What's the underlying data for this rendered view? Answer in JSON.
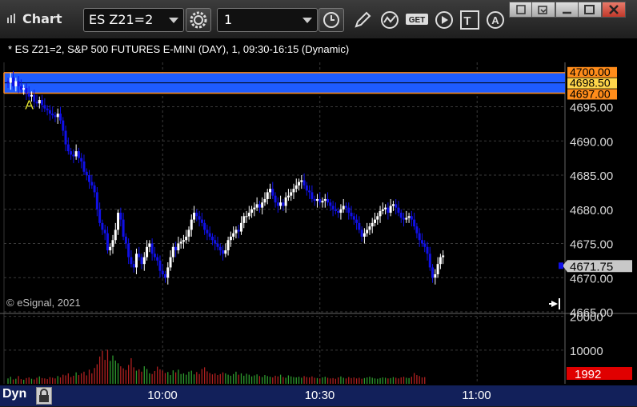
{
  "toolbar": {
    "app_title": "Chart",
    "symbol": "ES Z21=2",
    "interval": "1"
  },
  "chart_info": "* ES Z21=2, S&P 500 FUTURES E-MINI (DAY), 1, 09:30-16:15 (Dynamic)",
  "watermark": "© eSignal, 2021",
  "bottom": {
    "mode": "Dyn"
  },
  "colors": {
    "up": "#ffffff",
    "down": "#1010e8",
    "band": "#1e5cff",
    "band_edge": "#ff8c1a",
    "last_price": "#c8c8c8",
    "vol_up": "#2e9a2e",
    "vol_down": "#b02020",
    "vol_tag": "#e00000"
  },
  "icons": [
    "settings-gear-icon",
    "clock-icon",
    "pencil-draw-icon",
    "study-icon",
    "get-icon",
    "play-icon",
    "text-tool-icon",
    "alert-icon"
  ],
  "chart_data": {
    "type": "candlestick",
    "price_axis": {
      "min": 4665,
      "max": 4700,
      "ticks": [
        4695,
        4690,
        4685,
        4680,
        4675,
        4670,
        4665
      ]
    },
    "price_tick_labels": [
      "4695.00",
      "4690.00",
      "4685.00",
      "4680.00",
      "4675.00",
      "4670.00",
      "4665.00"
    ],
    "levels": [
      {
        "label": "4700.00",
        "value": 4700.0
      },
      {
        "label": "4698.50",
        "value": 4698.5
      },
      {
        "label": "4697.00",
        "value": 4697.0
      }
    ],
    "last_price": {
      "label": "4671.75",
      "value": 4671.75
    },
    "marker": {
      "label": "A"
    },
    "time_labels": [
      {
        "label": "10:00",
        "minute": 30
      },
      {
        "label": "10:30",
        "minute": 60
      },
      {
        "label": "11:00",
        "minute": 90
      }
    ],
    "volume_axis": {
      "min": 0,
      "max": 20000,
      "ticks": [
        20000,
        10000
      ],
      "tick_labels": [
        "20000",
        "10000"
      ]
    },
    "last_volume": {
      "label": "1992",
      "value": 1992
    },
    "first_minute": 0.5,
    "close": [
      4698.5,
      4699.25,
      4698,
      4698.75,
      4698,
      4697.5,
      4697.75,
      4697,
      4696.5,
      4696.75,
      4695.75,
      4695.5,
      4696,
      4695.25,
      4694.75,
      4694.5,
      4694,
      4693.75,
      4693.5,
      4694,
      4693,
      4691.5,
      4689.5,
      4688.5,
      4688,
      4687.75,
      4688.5,
      4687.5,
      4687,
      4685.5,
      4685,
      4684,
      4683.5,
      4682.5,
      4680,
      4678,
      4677,
      4676.5,
      4674,
      4674.5,
      4675.5,
      4677,
      4679.5,
      4678.5,
      4676,
      4675,
      4673,
      4672,
      4671.5,
      4673.5,
      4673,
      4672,
      4673,
      4674.5,
      4675,
      4673.5,
      4673,
      4672.5,
      4671,
      4670.5,
      4670,
      4671.5,
      4673,
      4674.5,
      4674,
      4675,
      4675.25,
      4675.5,
      4676,
      4677,
      4678.5,
      4679.5,
      4679,
      4678.5,
      4678,
      4677,
      4676.5,
      4676,
      4675.5,
      4675,
      4674.5,
      4674,
      4673.5,
      4674,
      4675.5,
      4676,
      4676.5,
      4677,
      4676.75,
      4678,
      4679,
      4679,
      4679.5,
      4680,
      4680.25,
      4680.75,
      4680.25,
      4681,
      4681.5,
      4682.5,
      4683,
      4682,
      4681,
      4680.5,
      4681,
      4680.5,
      4681.75,
      4682,
      4682.5,
      4683,
      4683.5,
      4684,
      4684.25,
      4683.5,
      4682.75,
      4682.5,
      4681.5,
      4681.25,
      4681.5,
      4681,
      4681.25,
      4681.5,
      4681,
      4680.5,
      4680,
      4679.75,
      4679.5,
      4680,
      4680.5,
      4680.25,
      4679.5,
      4679,
      4678.5,
      4678,
      4677,
      4676,
      4676.5,
      4677,
      4677.5,
      4678,
      4678.5,
      4679,
      4679.75,
      4680,
      4680.25,
      4679.5,
      4680.5,
      4680.75,
      4680.25,
      4679.5,
      4678.75,
      4678.5,
      4678.75,
      4679,
      4678.5,
      4677.5,
      4676.5,
      4675.5,
      4675,
      4674.5,
      4673.5,
      4671.5,
      4670,
      4670.5,
      4672,
      4673,
      4673.25
    ],
    "volume": [
      1600,
      2100,
      1300,
      1500,
      2300,
      1400,
      1200,
      1700,
      1900,
      1500,
      1300,
      1800,
      2200,
      1700,
      1600,
      1400,
      2000,
      1800,
      1600,
      2300,
      1900,
      2700,
      2500,
      3100,
      2000,
      2400,
      3400,
      2600,
      3100,
      3600,
      2500,
      4200,
      3100,
      4700,
      5800,
      8100,
      9800,
      7100,
      10100,
      6800,
      8400,
      6900,
      6100,
      5200,
      4600,
      4100,
      5600,
      7600,
      4900,
      3900,
      4300,
      3600,
      5200,
      4400,
      3100,
      2900,
      3800,
      5100,
      4300,
      3900,
      3200,
      3500,
      2600,
      4000,
      3400,
      4200,
      2900,
      3100,
      2700,
      3600,
      3900,
      2800,
      3500,
      2900,
      4400,
      4900,
      3700,
      3200,
      2800,
      3100,
      2600,
      2900,
      3400,
      3100,
      2700,
      2400,
      2900,
      3600,
      2700,
      3100,
      2400,
      3000,
      2700,
      2200,
      2500,
      2800,
      2300,
      2000,
      2600,
      2300,
      2100,
      1900,
      2400,
      2200,
      2700,
      2000,
      1800,
      2500,
      2200,
      2000,
      1900,
      2100,
      1800,
      2300,
      2000,
      1900,
      2200,
      1800,
      1700,
      1600,
      1900,
      2100,
      1800,
      1600,
      1700,
      1500,
      1900,
      2200,
      1800,
      1600,
      2000,
      1700,
      1900,
      1600,
      1800,
      1500,
      1700,
      1900,
      2100,
      1800,
      1600,
      1500,
      1700,
      1900,
      1800,
      1600,
      1700,
      2000,
      1800,
      1600,
      1900,
      2100,
      1800,
      1700,
      2100,
      3200,
      2600,
      2300,
      1900,
      1992
    ]
  }
}
